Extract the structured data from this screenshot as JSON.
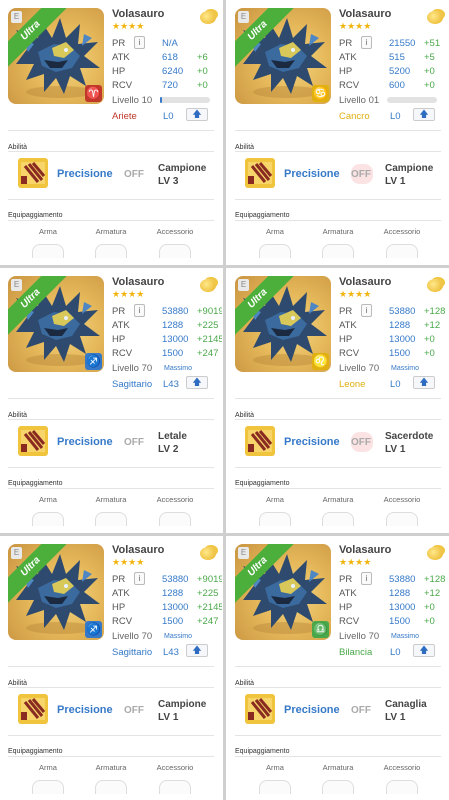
{
  "labels": {
    "abilities": "Abilità",
    "equipment": "Equipaggiamento",
    "slots": [
      "Arma",
      "Armatura",
      "Accessorio"
    ],
    "stats": [
      "PR",
      "ATK",
      "HP",
      "RCV"
    ],
    "skill": "Precisione",
    "off": "OFF",
    "max": "Massimo",
    "ultra": "Ultra",
    "e_badge": "E",
    "info": "i",
    "up_arrow": "🡅",
    "stars": "★★★★"
  },
  "colors": {
    "accent_blue": "#3579c8",
    "increase_green": "#4aa84a",
    "aries_red": "#c0392b",
    "cancer_yellow": "#e0b010",
    "leo_yellow": "#e0b010",
    "libra_green": "#4aa84a",
    "sagittarius_blue": "#3579c8"
  },
  "cards": [
    {
      "name": "Volasauro",
      "pr": "N/A",
      "pr_inc": "",
      "atk": "618",
      "atk_inc": "+6",
      "hp": "6240",
      "hp_inc": "+0",
      "rcv": "720",
      "rcv_inc": "+0",
      "level": "Livello 10",
      "level_progress": 0.04,
      "sign": "Ariete",
      "sign_color": "#c0392b",
      "sign_icon": "aries-icon",
      "sign_glyph": "♈",
      "sign_bg": "#c0392b",
      "lnum": "L0",
      "leader": "Campione",
      "leader_lv": "LV 3",
      "heart": false
    },
    {
      "name": "Volasauro",
      "pr": "21550",
      "pr_inc": "+51",
      "atk": "515",
      "atk_inc": "+5",
      "hp": "5200",
      "hp_inc": "+0",
      "rcv": "600",
      "rcv_inc": "+0",
      "level": "Livello 01",
      "level_progress": 0.0,
      "sign": "Cancro",
      "sign_color": "#e0b010",
      "sign_icon": "cancer-icon",
      "sign_glyph": "♋",
      "sign_bg": "#e0b010",
      "lnum": "L0",
      "leader": "Campione",
      "leader_lv": "LV 1",
      "heart": true
    },
    {
      "name": "Volasauro",
      "pr": "53880",
      "pr_inc": "+9019",
      "atk": "1288",
      "atk_inc": "+225",
      "hp": "13000",
      "hp_inc": "+2145",
      "rcv": "1500",
      "rcv_inc": "+247",
      "level": "Livello 70",
      "max": true,
      "sign": "Sagittario",
      "sign_color": "#3579c8",
      "sign_icon": "sagittarius-icon",
      "sign_glyph": "♐",
      "sign_bg": "#3579c8",
      "lnum": "L43",
      "leader": "Letale",
      "leader_lv": "LV 2",
      "heart": false
    },
    {
      "name": "Volasauro",
      "pr": "53880",
      "pr_inc": "+128",
      "atk": "1288",
      "atk_inc": "+12",
      "hp": "13000",
      "hp_inc": "+0",
      "rcv": "1500",
      "rcv_inc": "+0",
      "level": "Livello 70",
      "max": true,
      "sign": "Leone",
      "sign_color": "#e0b010",
      "sign_icon": "leo-icon",
      "sign_glyph": "♌",
      "sign_bg": "#e0b010",
      "lnum": "L0",
      "leader": "Sacerdote",
      "leader_lv": "LV 1",
      "heart": true
    },
    {
      "name": "Volasauro",
      "pr": "53880",
      "pr_inc": "+9019",
      "atk": "1288",
      "atk_inc": "+225",
      "hp": "13000",
      "hp_inc": "+2145",
      "rcv": "1500",
      "rcv_inc": "+247",
      "level": "Livello 70",
      "max": true,
      "sign": "Sagittario",
      "sign_color": "#3579c8",
      "sign_icon": "sagittarius-icon",
      "sign_glyph": "♐",
      "sign_bg": "#3579c8",
      "lnum": "L43",
      "leader": "Campione",
      "leader_lv": "LV 1",
      "heart": false
    },
    {
      "name": "Volasauro",
      "pr": "53880",
      "pr_inc": "+128",
      "atk": "1288",
      "atk_inc": "+12",
      "hp": "13000",
      "hp_inc": "+0",
      "rcv": "1500",
      "rcv_inc": "+0",
      "level": "Livello 70",
      "max": true,
      "sign": "Bilancia",
      "sign_color": "#4aa84a",
      "sign_icon": "libra-icon",
      "sign_glyph": "♎",
      "sign_bg": "#4aa84a",
      "lnum": "L0",
      "leader": "Canaglia",
      "leader_lv": "LV 1",
      "heart": false
    }
  ]
}
